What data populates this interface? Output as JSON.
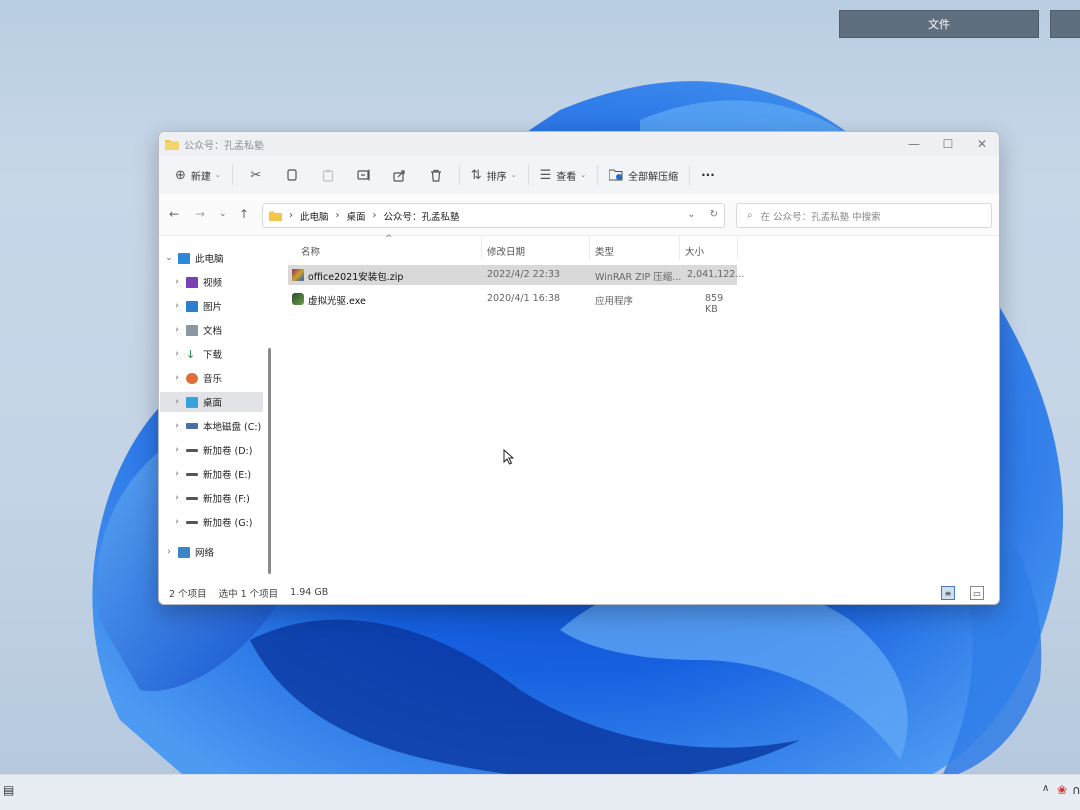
{
  "overlay": {
    "button_label": "文件"
  },
  "window": {
    "title": "公众号：孔孟私塾",
    "controls": {
      "minimize": "—",
      "maximize": "☐",
      "close": "✕"
    }
  },
  "commandbar": {
    "new_label": "新建",
    "sort_label": "排序",
    "view_label": "查看",
    "extract_label": "全部解压缩",
    "more_label": "···"
  },
  "address": {
    "crumbs": [
      "此电脑",
      "桌面",
      "公众号：孔孟私塾"
    ],
    "search_placeholder": "在 公众号：孔孟私塾 中搜索"
  },
  "navpane": {
    "items": [
      {
        "label": "此电脑",
        "icon": "pc-icon",
        "color": "#2b8ad8"
      },
      {
        "label": "视频",
        "icon": "video-icon",
        "color": "#7b3fb8"
      },
      {
        "label": "图片",
        "icon": "pictures-icon",
        "color": "#2a7fd0"
      },
      {
        "label": "文档",
        "icon": "documents-icon",
        "color": "#8d96a3"
      },
      {
        "label": "下载",
        "icon": "downloads-icon",
        "color": "#1e8a52"
      },
      {
        "label": "音乐",
        "icon": "music-icon",
        "color": "#e06c3a"
      },
      {
        "label": "桌面",
        "icon": "desktop-icon",
        "color": "#37a1dc"
      },
      {
        "label": "本地磁盘 (C:)",
        "icon": "drive-c-icon",
        "color": "#4a6fa5"
      },
      {
        "label": "新加卷 (D:)",
        "icon": "drive-icon",
        "color": "#555555"
      },
      {
        "label": "新加卷 (E:)",
        "icon": "drive-icon",
        "color": "#555555"
      },
      {
        "label": "新加卷 (F:)",
        "icon": "drive-icon",
        "color": "#555555"
      },
      {
        "label": "新加卷 (G:)",
        "icon": "drive-icon",
        "color": "#555555"
      },
      {
        "label": "网络",
        "icon": "network-icon",
        "color": "#3b86c6"
      }
    ]
  },
  "columns": {
    "name": "名称",
    "modified": "修改日期",
    "type": "类型",
    "size": "大小"
  },
  "files": [
    {
      "name": "office2021安装包.zip",
      "modified": "2022/4/2 22:33",
      "type": "WinRAR ZIP 压缩...",
      "size": "2,041,122...",
      "icon": "zip-icon"
    },
    {
      "name": "虚拟光驱.exe",
      "modified": "2020/4/1 16:38",
      "type": "应用程序",
      "size": "859 KB",
      "icon": "exe-icon"
    }
  ],
  "status": {
    "count": "2 个项目",
    "selected": "选中 1 个项目",
    "size": "1.94 GB"
  },
  "colors": {
    "accent": "#0067c0",
    "selection": "#d9d9d9",
    "folder": "#f4c54a"
  }
}
